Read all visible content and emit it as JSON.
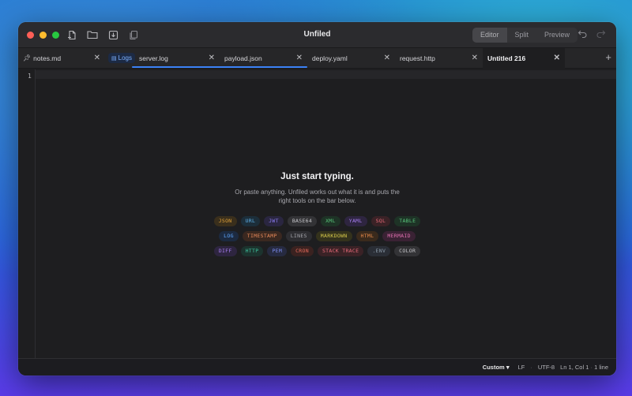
{
  "window": {
    "title": "Unfiled"
  },
  "view_modes": [
    {
      "label": "Editor",
      "active": true
    },
    {
      "label": "Split",
      "active": false
    },
    {
      "label": "Preview",
      "active": false
    }
  ],
  "toolbar_icons": [
    "new-file-icon",
    "folder-icon",
    "download-icon",
    "copy-icon"
  ],
  "tabs": [
    {
      "label": "notes.md",
      "pinned": true
    },
    {
      "label": "server.log",
      "badge": "Logs"
    },
    {
      "label": "payload.json"
    },
    {
      "label": "deploy.yaml"
    },
    {
      "label": "request.http"
    },
    {
      "label": "Untitled 216",
      "active": true
    }
  ],
  "editor": {
    "line_number": "1"
  },
  "empty_state": {
    "headline": "Just start typing.",
    "sub_line1": "Or paste anything. Unfiled works out what it is and puts the",
    "sub_line2": "right tools on the bar below."
  },
  "chips": [
    [
      {
        "label": "JSON",
        "color": "#e0a23a",
        "bg": "#3a2f1c"
      },
      {
        "label": "URL",
        "color": "#5fb0e8",
        "bg": "#1c2e3a"
      },
      {
        "label": "JWT",
        "color": "#8b7cf0",
        "bg": "#2a2640"
      },
      {
        "label": "BASE64",
        "color": "#c4c4c8",
        "bg": "#333336"
      },
      {
        "label": "XML",
        "color": "#58c47a",
        "bg": "#1e3326"
      },
      {
        "label": "YAML",
        "color": "#a77ef0",
        "bg": "#2e2540"
      },
      {
        "label": "SQL",
        "color": "#e86a78",
        "bg": "#3a2226"
      },
      {
        "label": "TABLE",
        "color": "#58c47a",
        "bg": "#1e3326"
      }
    ],
    [
      {
        "label": "LOG",
        "color": "#5fa8ff",
        "bg": "#1c2a40"
      },
      {
        "label": "TIMESTAMP",
        "color": "#e88a5a",
        "bg": "#3a2820"
      },
      {
        "label": "LINES",
        "color": "#a4a4aa",
        "bg": "#2e2e32"
      },
      {
        "label": "MARKDOWN",
        "color": "#d6c84a",
        "bg": "#34321c"
      },
      {
        "label": "HTML",
        "color": "#e88a4a",
        "bg": "#3a2a1c"
      },
      {
        "label": "MERMAID",
        "color": "#e070b0",
        "bg": "#3a2234"
      }
    ],
    [
      {
        "label": "DIFF",
        "color": "#a77ef0",
        "bg": "#2e2540"
      },
      {
        "label": "HTTP",
        "color": "#3ec4a0",
        "bg": "#1c332e"
      },
      {
        "label": "PEM",
        "color": "#7c8cf0",
        "bg": "#262a40"
      },
      {
        "label": "CRON",
        "color": "#e86a5a",
        "bg": "#3a2220"
      },
      {
        "label": "STACK TRACE",
        "color": "#e86a78",
        "bg": "#3a2226"
      },
      {
        "label": ".ENV",
        "color": "#8a9aa8",
        "bg": "#2a2e36"
      },
      {
        "label": "COLOR",
        "color": "#c4c4c8",
        "bg": "#333336"
      }
    ]
  ],
  "status": {
    "mode": "Custom",
    "line_ending": "LF",
    "encoding": "UTF-8",
    "position": "Ln 1, Col 1",
    "line_count": "1 line"
  }
}
